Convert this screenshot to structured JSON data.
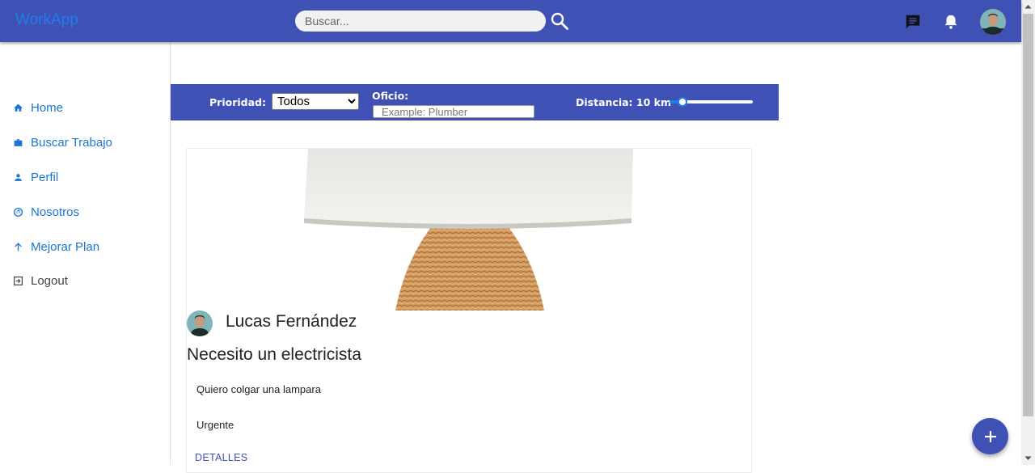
{
  "app": {
    "brand": "WorkApp"
  },
  "topbar": {
    "search_placeholder": "Buscar...",
    "icons": [
      "search-icon",
      "chat-icon",
      "notifications-bell-icon",
      "user-avatar"
    ]
  },
  "sidebar": {
    "items": [
      {
        "label": "Home",
        "icon": "home-icon"
      },
      {
        "label": "Buscar Trabajo",
        "icon": "briefcase-icon"
      },
      {
        "label": "Perfil",
        "icon": "person-icon"
      },
      {
        "label": "Nosotros",
        "icon": "face-icon"
      },
      {
        "label": "Mejorar Plan",
        "icon": "arrow-up-icon"
      },
      {
        "label": "Logout",
        "icon": "logout-icon"
      }
    ]
  },
  "filters": {
    "priority_label": "Prioridad:",
    "priority_value": "Todos",
    "priority_options": [
      "Todos"
    ],
    "oficio_label": "Oficio:",
    "oficio_placeholder": "Example: Plumber",
    "distance_label": "Distancia: 10 km",
    "distance_fraction": 0.1
  },
  "post": {
    "author": "Lucas Fernández",
    "title": "Necesito un electricista",
    "description": "Quiero colgar una lampara",
    "priority": "Urgente",
    "details_label": "DETALLES"
  },
  "colors": {
    "primary": "#3f51b5",
    "link": "#1976d2",
    "accent": "#1e7fe8"
  }
}
